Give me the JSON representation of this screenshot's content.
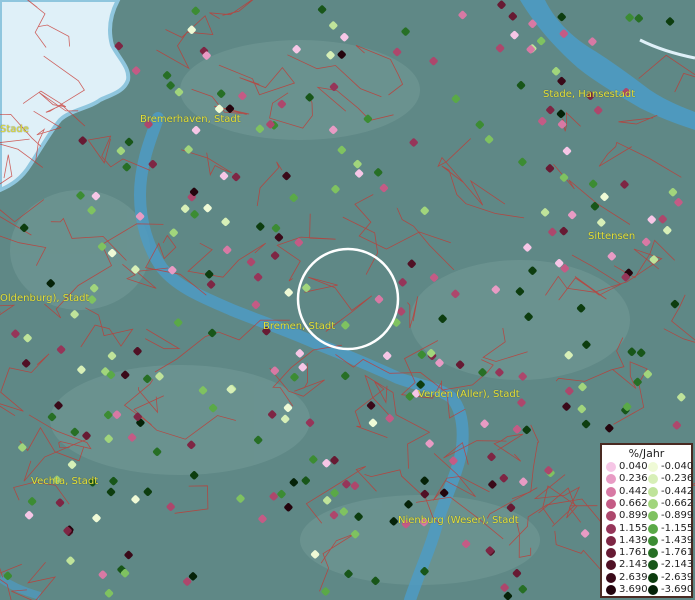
{
  "map": {
    "cities": [
      "Stade",
      "Bremerhaven, Stadt",
      "Stade, Hansestadt",
      "Sittensen",
      "Oldenburg), Stadt",
      "Bremen, Stadt",
      "Verden (Aller), Stadt",
      "Vechta, Stadt",
      "Nienburg (Weser), Stadt"
    ],
    "colors": {
      "water": "#dff0f8",
      "river": "#4d9bc4",
      "land": "#5f8886",
      "borders": "#c8342e",
      "selection_ring": "#ffffff"
    }
  },
  "legend": {
    "title": "%/Jahr",
    "positive": [
      {
        "label": "0.040",
        "color": "#f6c6e6"
      },
      {
        "label": "0.236",
        "color": "#e89bc4"
      },
      {
        "label": "0.442",
        "color": "#d879a4"
      },
      {
        "label": "0.662",
        "color": "#c45b85"
      },
      {
        "label": "0.899",
        "color": "#ad476c"
      },
      {
        "label": "1.155",
        "color": "#963559"
      },
      {
        "label": "1.439",
        "color": "#7e2644"
      },
      {
        "label": "1.761",
        "color": "#671a33"
      },
      {
        "label": "2.143",
        "color": "#501125"
      },
      {
        "label": "2.639",
        "color": "#3a0a19"
      },
      {
        "label": "3.690",
        "color": "#24040d"
      }
    ],
    "negative": [
      {
        "label": "-0.040",
        "color": "#effad6"
      },
      {
        "label": "-0.236",
        "color": "#d7efb7"
      },
      {
        "label": "-0.442",
        "color": "#bfe39a"
      },
      {
        "label": "-0.662",
        "color": "#a1d57c"
      },
      {
        "label": "-0.899",
        "color": "#7fc260"
      },
      {
        "label": "-1.155",
        "color": "#5aa947"
      },
      {
        "label": "-1.439",
        "color": "#3c8c33"
      },
      {
        "label": "-1.761",
        "color": "#276f25"
      },
      {
        "label": "-2.143",
        "color": "#185619"
      },
      {
        "label": "-2.639",
        "color": "#0d3d0f"
      },
      {
        "label": "-3.690",
        "color": "#052208"
      }
    ]
  }
}
